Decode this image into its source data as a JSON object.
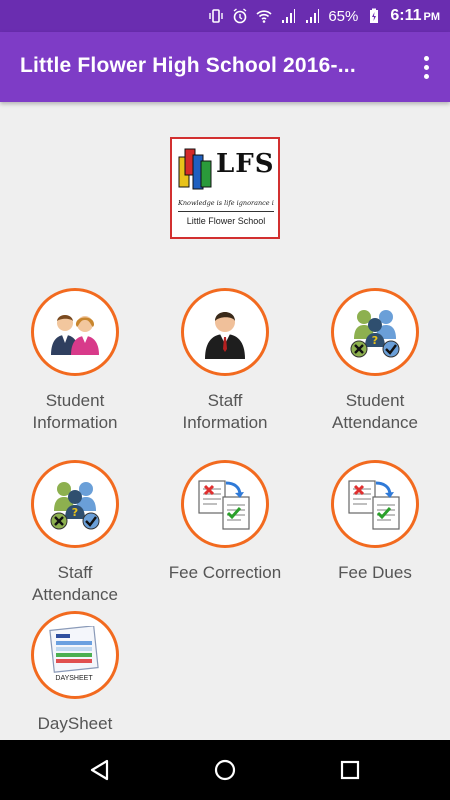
{
  "status_bar": {
    "battery_percent": "65%",
    "time": "6:11",
    "time_suffix": "PM",
    "icons": [
      "vibrate-icon",
      "alarm-icon",
      "wifi-icon",
      "signal-sim1-icon",
      "signal-sim2-icon",
      "battery-charging-icon"
    ]
  },
  "app_bar": {
    "title": "Little Flower High School 2016-...",
    "menu_icon": "more-vert-icon"
  },
  "logo": {
    "letters": "LFS",
    "tagline": "Knowledge is life ignorance is Death",
    "school_name": "Little Flower School"
  },
  "tiles": [
    {
      "line1": "Student",
      "line2": "Information",
      "icon": "students-icon"
    },
    {
      "line1": "Staff",
      "line2": "Information",
      "icon": "staff-icon"
    },
    {
      "line1": "Student",
      "line2": "Attendance",
      "icon": "attendance-icon"
    },
    {
      "line1": "Staff",
      "line2": "Attendance",
      "icon": "attendance-icon"
    },
    {
      "line1": "Fee Correction",
      "line2": "",
      "icon": "fee-correction-icon"
    },
    {
      "line1": "Fee Dues",
      "line2": "",
      "icon": "fee-dues-icon"
    },
    {
      "line1": "DaySheet",
      "line2": "",
      "icon": "daysheet-icon",
      "icon_caption": "DAYSHEET"
    }
  ],
  "nav_bar": {
    "back_icon": "back-icon",
    "home_icon": "home-icon",
    "recents_icon": "recents-icon"
  },
  "colors": {
    "status_bar": "#6a2db0",
    "app_bar": "#7e3cc6",
    "circle_border": "#f26a1f",
    "background": "#efefef"
  }
}
